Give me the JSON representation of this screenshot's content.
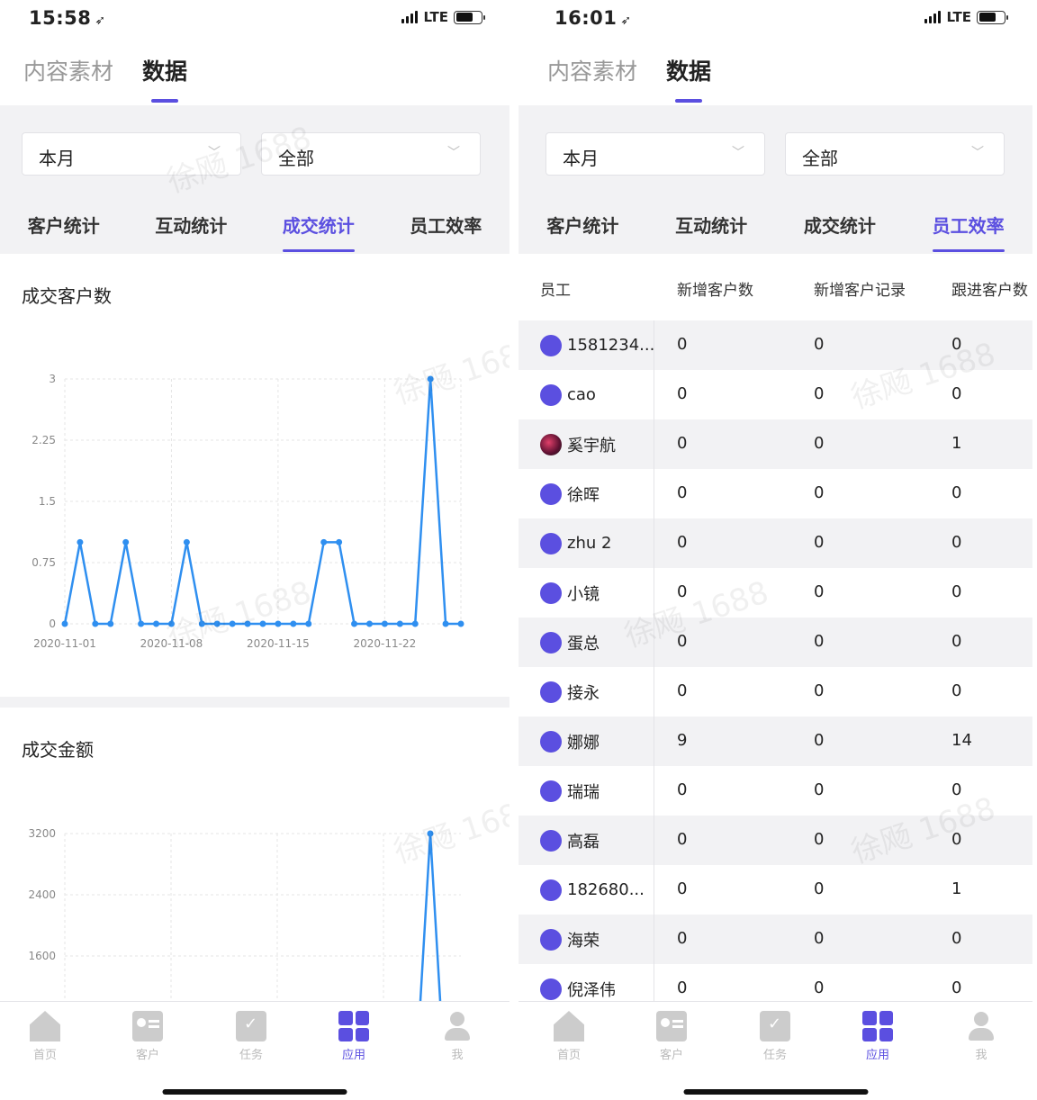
{
  "left": {
    "status": {
      "time": "15:58",
      "network": "LTE"
    },
    "top_tabs": [
      "内容素材",
      "数据"
    ],
    "filters": {
      "period": "本月",
      "scope": "全部"
    },
    "stat_tabs": [
      "客户统计",
      "互动统计",
      "成交统计",
      "员工效率"
    ],
    "active_stat_tab": "成交统计",
    "card1_title": "成交客户数",
    "card2_title": "成交金额"
  },
  "right": {
    "status": {
      "time": "16:01",
      "network": "LTE"
    },
    "top_tabs": [
      "内容素材",
      "数据"
    ],
    "filters": {
      "period": "本月",
      "scope": "全部"
    },
    "stat_tabs": [
      "客户统计",
      "互动统计",
      "成交统计",
      "员工效率"
    ],
    "active_stat_tab": "员工效率",
    "table_headers": [
      "员工",
      "新增客户数",
      "新增客户记录",
      "跟进客户数"
    ],
    "rows": [
      {
        "name": "1581234...",
        "new_customers": "0",
        "new_records": "0",
        "followed": "0"
      },
      {
        "name": "cao",
        "new_customers": "0",
        "new_records": "0",
        "followed": "0"
      },
      {
        "name": "奚宇航",
        "new_customers": "0",
        "new_records": "0",
        "followed": "1"
      },
      {
        "name": "徐晖",
        "new_customers": "0",
        "new_records": "0",
        "followed": "0"
      },
      {
        "name": "zhu 2",
        "new_customers": "0",
        "new_records": "0",
        "followed": "0"
      },
      {
        "name": "小镜",
        "new_customers": "0",
        "new_records": "0",
        "followed": "0"
      },
      {
        "name": "蛋总",
        "new_customers": "0",
        "new_records": "0",
        "followed": "0"
      },
      {
        "name": "接永",
        "new_customers": "0",
        "new_records": "0",
        "followed": "0"
      },
      {
        "name": "娜娜",
        "new_customers": "9",
        "new_records": "0",
        "followed": "14"
      },
      {
        "name": "瑞瑞",
        "new_customers": "0",
        "new_records": "0",
        "followed": "0"
      },
      {
        "name": "高磊",
        "new_customers": "0",
        "new_records": "0",
        "followed": "0"
      },
      {
        "name": "182680...",
        "new_customers": "0",
        "new_records": "0",
        "followed": "1"
      },
      {
        "name": "海荣",
        "new_customers": "0",
        "new_records": "0",
        "followed": "0"
      },
      {
        "name": "倪泽伟",
        "new_customers": "0",
        "new_records": "0",
        "followed": "0"
      }
    ]
  },
  "tabbar": [
    "首页",
    "客户",
    "任务",
    "应用",
    "我"
  ],
  "tabbar_active": "应用",
  "watermark": "徐飏 1688",
  "colors": {
    "accent": "#5b4fe0",
    "line": "#2f8ff0"
  },
  "chart_data": [
    {
      "type": "line",
      "title": "成交客户数",
      "x": [
        "2020-11-01",
        "2020-11-02",
        "2020-11-03",
        "2020-11-04",
        "2020-11-05",
        "2020-11-06",
        "2020-11-07",
        "2020-11-08",
        "2020-11-09",
        "2020-11-10",
        "2020-11-11",
        "2020-11-12",
        "2020-11-13",
        "2020-11-14",
        "2020-11-15",
        "2020-11-16",
        "2020-11-17",
        "2020-11-18",
        "2020-11-19",
        "2020-11-20",
        "2020-11-21",
        "2020-11-22",
        "2020-11-23",
        "2020-11-24",
        "2020-11-25",
        "2020-11-26",
        "2020-11-27"
      ],
      "values": [
        0,
        1,
        0,
        0,
        1,
        0,
        0,
        0,
        1,
        0,
        0,
        0,
        0,
        0,
        0,
        0,
        0,
        1,
        1,
        0,
        0,
        0,
        0,
        0,
        3,
        0,
        0
      ],
      "x_ticks": [
        "2020-11-01",
        "2020-11-08",
        "2020-11-15",
        "2020-11-22"
      ],
      "y_ticks": [
        "0",
        "0.75",
        "1.5",
        "2.25",
        "3"
      ],
      "ylim": [
        0,
        3
      ],
      "grid": true
    },
    {
      "type": "line",
      "title": "成交金额",
      "y_ticks": [
        "1600",
        "2400",
        "3200"
      ],
      "ylim": [
        0,
        3200
      ],
      "x": [
        "2020-11-25"
      ],
      "values": [
        3200
      ],
      "grid": true
    }
  ]
}
